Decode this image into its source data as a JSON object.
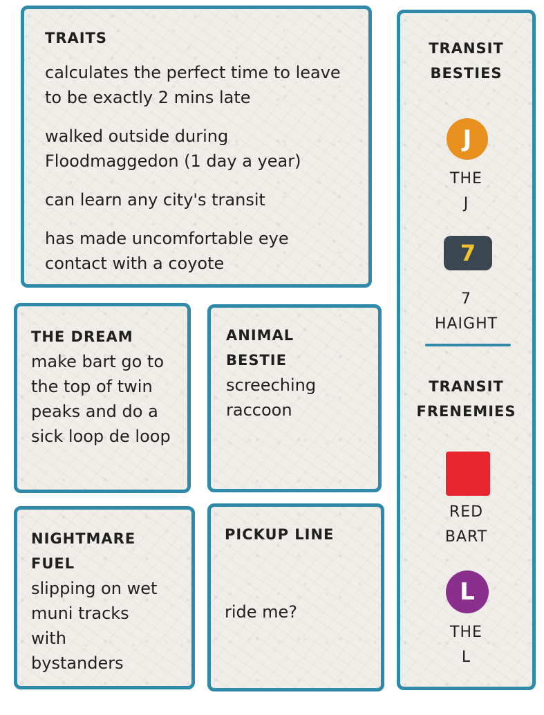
{
  "traits": {
    "heading": "TRAITS",
    "items": [
      "calculates the perfect time to leave to be exactly 2 mins late",
      "walked outside during Floodmaggedon (1 day a year)",
      "can learn any city's transit",
      "has made uncomfortable eye contact with a coyote"
    ]
  },
  "dream": {
    "heading": "THE DREAM",
    "text": "make bart go to the top of twin peaks and do a sick loop de loop"
  },
  "animal_bestie": {
    "heading": "ANIMAL BESTIE",
    "text": "screeching raccoon"
  },
  "nightmare": {
    "heading": "NIGHTMARE FUEL",
    "text": "slipping on wet muni tracks with bystanders"
  },
  "pickup": {
    "heading": "PICKUP LINE",
    "text": "ride me?"
  },
  "sidebar": {
    "besties_heading_1": "TRANSIT",
    "besties_heading_2": "BESTIES",
    "besties": [
      {
        "badge": "J",
        "label_1": "THE",
        "label_2": "J",
        "color": "#e8901e"
      },
      {
        "badge": "7",
        "label_1": "7",
        "label_2": "HAIGHT",
        "color": "#3a4650",
        "badge_text_color": "#f2c230"
      }
    ],
    "frenemies_heading_1": "TRANSIT",
    "frenemies_heading_2": "FRENEMIES",
    "frenemies": [
      {
        "badge": "",
        "label_1": "RED",
        "label_2": "BART",
        "color": "#e8262d"
      },
      {
        "badge": "L",
        "label_1": "THE",
        "label_2": "L",
        "color": "#8b2f8e"
      }
    ]
  }
}
